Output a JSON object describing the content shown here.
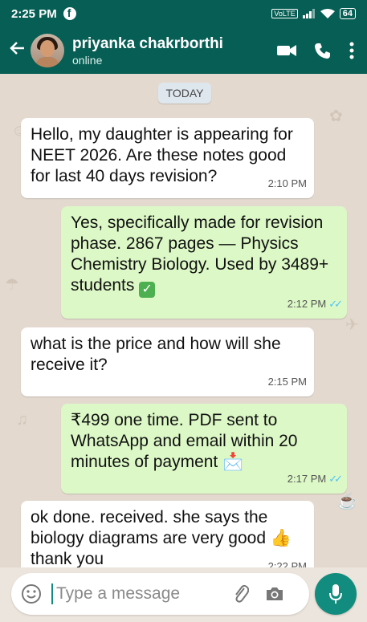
{
  "status_bar": {
    "time": "2:25 PM",
    "app_icon": "facebook-icon",
    "network": "VoLTE",
    "battery": "64"
  },
  "header": {
    "contact_name": "priyanka chakrborthi",
    "status": "online",
    "icons": [
      "back-arrow-icon",
      "video-call-icon",
      "voice-call-icon",
      "more-options-icon"
    ],
    "color": "#075e54"
  },
  "chat": {
    "date_label": "TODAY",
    "messages": [
      {
        "direction": "incoming",
        "text": "Hello, my daughter is appearing for NEET 2026. Are these notes good for last 40 days revision?",
        "time": "2:10 PM"
      },
      {
        "direction": "outgoing",
        "text": "Yes, specifically made for revision phase. 2867 pages — Physics Chemistry Biology. Used by 3489+ students",
        "emoji": "✅",
        "time": "2:12 PM",
        "ticks": "read"
      },
      {
        "direction": "incoming",
        "text": "what is the price and how will she receive it?",
        "time": "2:15 PM"
      },
      {
        "direction": "outgoing",
        "text": "₹499 one time. PDF sent to WhatsApp and email within 20 minutes of payment",
        "emoji": "📩",
        "time": "2:17 PM",
        "ticks": "read"
      },
      {
        "direction": "incoming",
        "text": "ok done. received. she says the biology diagrams are very good",
        "emoji": "👍",
        "text_after": "thank you",
        "time": "2:22 PM"
      }
    ]
  },
  "composer": {
    "placeholder": "Type a message",
    "icons": [
      "emoji-icon",
      "attach-icon",
      "camera-icon",
      "mic-icon"
    ]
  },
  "colors": {
    "incoming_bubble": "#ffffff",
    "outgoing_bubble": "#dcf8c6",
    "read_ticks": "#4fc3f7",
    "accent": "#128c7e"
  }
}
